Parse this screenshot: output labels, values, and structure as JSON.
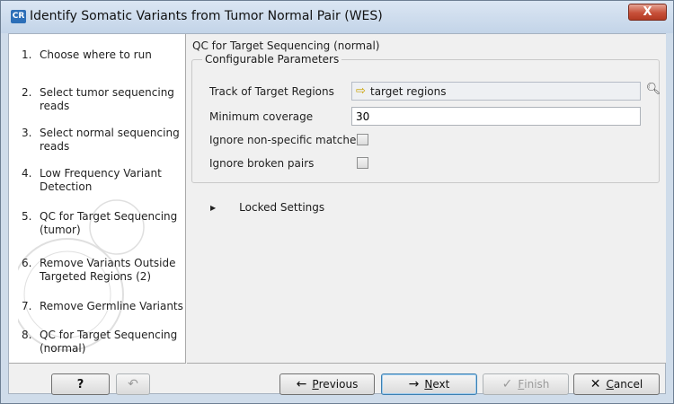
{
  "window": {
    "app_icon": "CR",
    "title": "Identify Somatic Variants from Tumor Normal Pair (WES)",
    "close_glyph": "X"
  },
  "steps": [
    {
      "num": "1.",
      "label": "Choose where to run"
    },
    {
      "num": "2.",
      "label": "Select tumor sequencing reads"
    },
    {
      "num": "3.",
      "label": "Select normal sequencing reads"
    },
    {
      "num": "4.",
      "label": "Low Frequency Variant Detection"
    },
    {
      "num": "5.",
      "label": "QC for Target Sequencing (tumor)"
    },
    {
      "num": "6.",
      "label": "Remove Variants Outside Targeted Regions (2)"
    },
    {
      "num": "7.",
      "label": "Remove Germline Variants"
    },
    {
      "num": "8.",
      "label": "QC for Target Sequencing (normal)"
    }
  ],
  "panel": {
    "section_title": "QC for Target Sequencing (normal)",
    "group_title": "Configurable Parameters",
    "track_label": "Track of Target Regions",
    "track_value": "target regions",
    "track_icon": "track-icon",
    "min_cov_label": "Minimum coverage",
    "min_cov_value": "30",
    "ignore_nonspecific_label": "Ignore non-specific matches",
    "ignore_nonspecific_checked": false,
    "ignore_broken_label": "Ignore broken pairs",
    "ignore_broken_checked": false,
    "locked_label": "Locked Settings"
  },
  "buttons": {
    "help": "?",
    "previous_prefix": "P",
    "previous_rest": "revious",
    "next_prefix": "N",
    "next_rest": "ext",
    "finish_prefix": "F",
    "finish_rest": "inish",
    "cancel_prefix": "C",
    "cancel_rest": "ancel"
  },
  "colors": {
    "title_bar": "#c3d4e8",
    "close_button": "#c75039",
    "dialog_bg": "#f0f0f0"
  }
}
